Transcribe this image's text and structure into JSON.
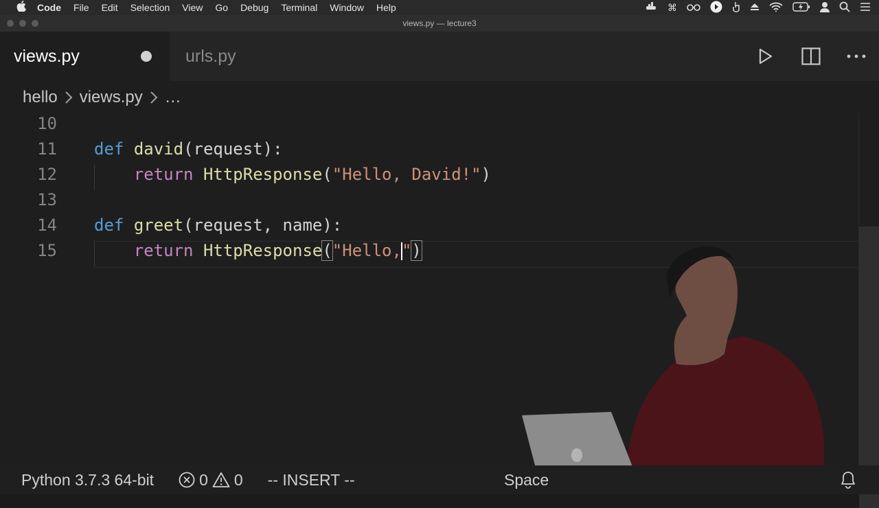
{
  "menubar": {
    "items": [
      "Code",
      "File",
      "Edit",
      "Selection",
      "View",
      "Go",
      "Debug",
      "Terminal",
      "Window",
      "Help"
    ]
  },
  "window": {
    "title": "views.py — lecture3"
  },
  "tabs": [
    {
      "label": "views.py",
      "active": true,
      "unsaved": true
    },
    {
      "label": "urls.py",
      "active": false
    }
  ],
  "breadcrumb": {
    "items": [
      "hello",
      "views.py",
      "…"
    ]
  },
  "editor": {
    "lines": [
      {
        "num": "10"
      },
      {
        "num": "11"
      },
      {
        "num": "12"
      },
      {
        "num": "13"
      },
      {
        "num": "14"
      },
      {
        "num": "15"
      }
    ],
    "code": {
      "l11_kw": "def",
      "l11_fn": "david",
      "l11_rest": "(request):",
      "l12_kw": "return",
      "l12_fn": "HttpResponse",
      "l12_open": "(",
      "l12_str": "\"Hello, David!\"",
      "l12_close": ")",
      "l14_kw": "def",
      "l14_fn": "greet",
      "l14_rest": "(request, name):",
      "l15_kw": "return",
      "l15_fn": "HttpResponse",
      "l15_open": "(",
      "l15_str_a": "\"Hello,",
      "l15_str_b": "\"",
      "l15_close": ")"
    }
  },
  "statusbar": {
    "interpreter": "Python 3.7.3 64-bit",
    "errors": "0",
    "warnings": "0",
    "mode": "-- INSERT --",
    "indent": "Space"
  },
  "colors": {
    "keyword": "#c586c0",
    "def_keyword": "#569cd6",
    "function": "#dcdcaa",
    "string": "#ce9178",
    "background": "#1e1e1e"
  }
}
